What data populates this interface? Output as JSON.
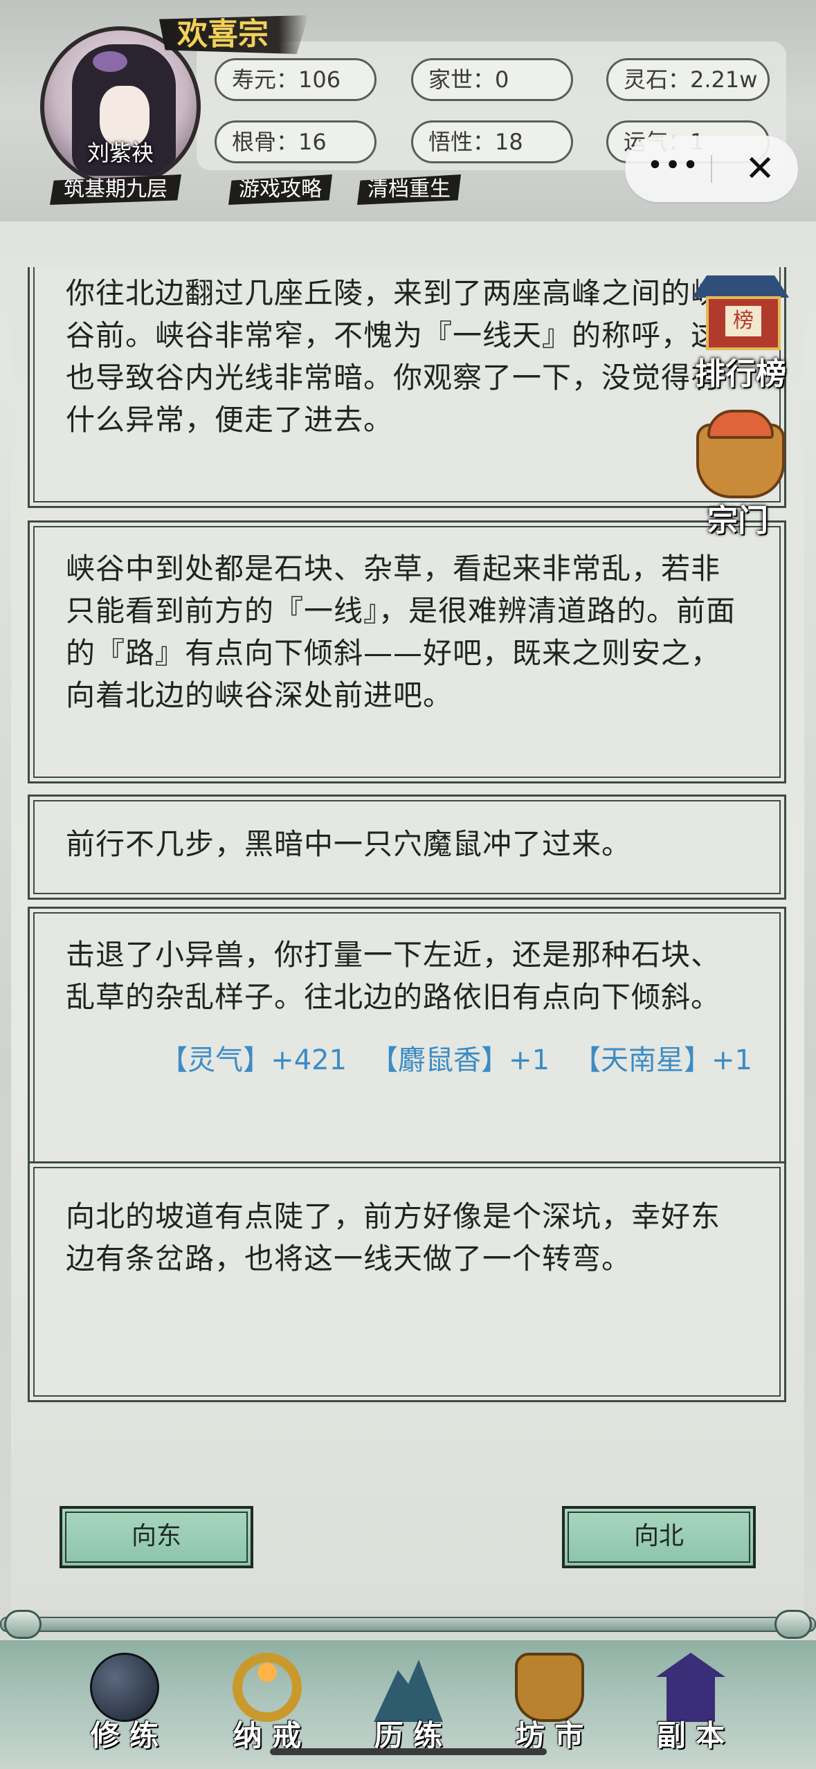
{
  "header": {
    "sect_name": "欢喜宗",
    "avatar_name": "刘紫袂",
    "realm": "筑基期九层",
    "links": [
      "游戏攻略",
      "清档重生"
    ],
    "stats": [
      {
        "label": "寿元：106"
      },
      {
        "label": "家世：0"
      },
      {
        "label": "灵石：2.21w"
      },
      {
        "label": "根骨：16"
      },
      {
        "label": "悟性：18"
      },
      {
        "label": "运气：1"
      }
    ],
    "capsule": {
      "more": "•••",
      "close": "✕"
    }
  },
  "side_buttons": {
    "rank": {
      "label": "排行榜",
      "sign": "榜"
    },
    "sect": {
      "label": "宗门"
    }
  },
  "story": {
    "cards": [
      {
        "text": "你往北边翻过几座丘陵，来到了两座高峰之间的峡谷前。峡谷非常窄，不愧为『一线天』的称呼，这也导致谷内光线非常暗。你观察了一下，没觉得有什么异常，便走了进去。"
      },
      {
        "text": "峡谷中到处都是石块、杂草，看起来非常乱，若非只能看到前方的『一线』，是很难辨清道路的。前面的『路』有点向下倾斜——好吧，既来之则安之，向着北边的峡谷深处前进吧。"
      },
      {
        "text": "前行不几步，黑暗中一只穴魔鼠冲了过来。"
      },
      {
        "text": "击退了小异兽，你打量一下左近，还是那种石块、乱草的杂乱样子。往北边的路依旧有点向下倾斜。",
        "rewards": [
          "【灵气】+421",
          "【麝鼠香】+1",
          "【天南星】+1"
        ]
      },
      {
        "text": "向北的坡道有点陡了，前方好像是个深坑，幸好东边有条岔路，也将这一线天做了一个转弯。"
      }
    ]
  },
  "actions": {
    "east": "向东",
    "north": "向北"
  },
  "nav": {
    "items": [
      {
        "label": "修 练",
        "icon": "yin-yang-icon"
      },
      {
        "label": "纳 戒",
        "icon": "ring-icon"
      },
      {
        "label": "历 练",
        "icon": "mountain-icon"
      },
      {
        "label": "坊 市",
        "icon": "cauldron-icon"
      },
      {
        "label": "副 本",
        "icon": "pavilion-icon"
      }
    ]
  },
  "colors": {
    "reward_blue": "#3d8bc4",
    "sect_gold": "#f2d15a",
    "button_green": "#a9d6c0"
  }
}
